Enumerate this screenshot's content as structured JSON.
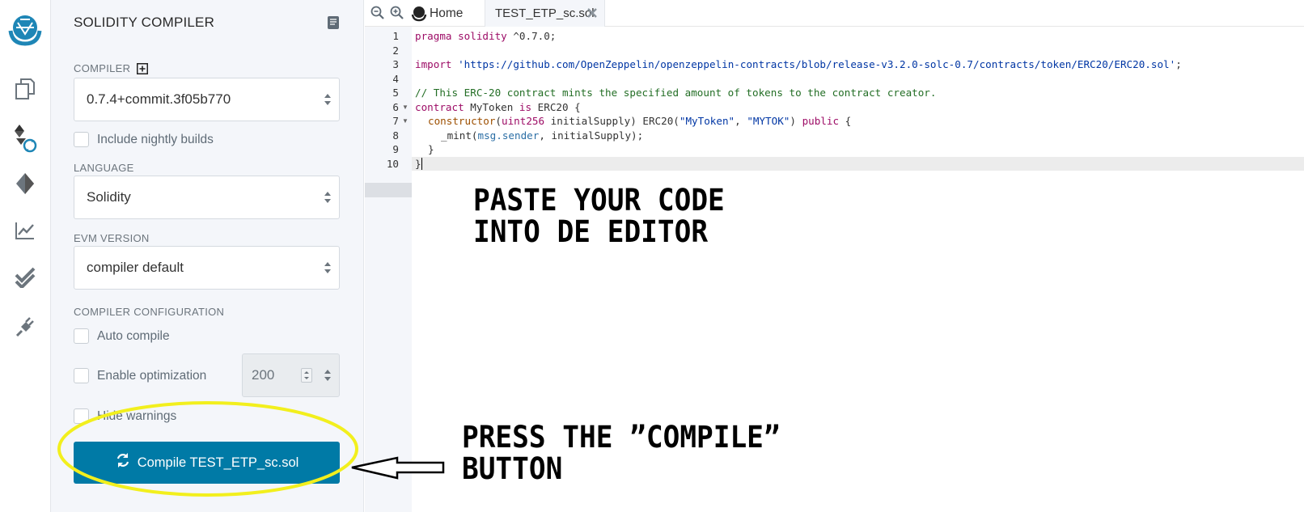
{
  "rail": {
    "icons": [
      "remix-logo-icon",
      "file-explorer-icon",
      "solidity-compiler-icon",
      "deploy-run-icon",
      "analysis-icon",
      "testing-icon",
      "plugin-manager-icon"
    ]
  },
  "panel": {
    "title": "SOLIDITY COMPILER",
    "compiler_label": "COMPILER",
    "compiler_value": "0.7.4+commit.3f05b770",
    "nightly_label": "Include nightly builds",
    "language_label": "LANGUAGE",
    "language_value": "Solidity",
    "evm_label": "EVM VERSION",
    "evm_value": "compiler default",
    "config_label": "COMPILER CONFIGURATION",
    "auto_compile_label": "Auto compile",
    "optimization_label": "Enable optimization",
    "runs_value": "200",
    "hide_warnings_label": "Hide warnings",
    "compile_button": "Compile TEST_ETP_sc.sol"
  },
  "tabs": {
    "home": "Home",
    "file": "TEST_ETP_sc.sol"
  },
  "editor": {
    "line_numbers": [
      "1",
      "2",
      "3",
      "4",
      "5",
      "6",
      "7",
      "8",
      "9",
      "10"
    ],
    "l1_kw": "pragma solidity",
    "l1_rest": " ^0.7.0;",
    "l3_kw": "import",
    "l3_str": "'https://github.com/OpenZeppelin/openzeppelin-contracts/blob/release-v3.2.0-solc-0.7/contracts/token/ERC20/ERC20.sol'",
    "l3_end": ";",
    "l5_comment": "// This ERC-20 contract mints the specified amount of tokens to the contract creator.",
    "l6_kw": "contract",
    "l6_name": " MyToken ",
    "l6_is": "is",
    "l6_rest": " ERC20 {",
    "l7_fn": "constructor",
    "l7_a": "(",
    "l7_type": "uint256",
    "l7_b": " initialSupply) ERC20(",
    "l7_s1": "\"MyToken\"",
    "l7_c": ", ",
    "l7_s2": "\"MYTOK\"",
    "l7_d": ") ",
    "l7_pub": "public",
    "l7_e": " {",
    "l8_a": "_mint(",
    "l8_msg": "msg.sender",
    "l8_b": ", initialSupply);",
    "l9": "}",
    "l10": "}"
  },
  "annotations": {
    "paste_1": "PASTE YOUR CODE",
    "paste_2": "INTO DE EDITOR",
    "press_1": "PRESS THE ”COMPILE”",
    "press_2": "BUTTON"
  },
  "colors": {
    "accent": "#007aa6",
    "highlight_ellipse": "#f2ef1d"
  }
}
